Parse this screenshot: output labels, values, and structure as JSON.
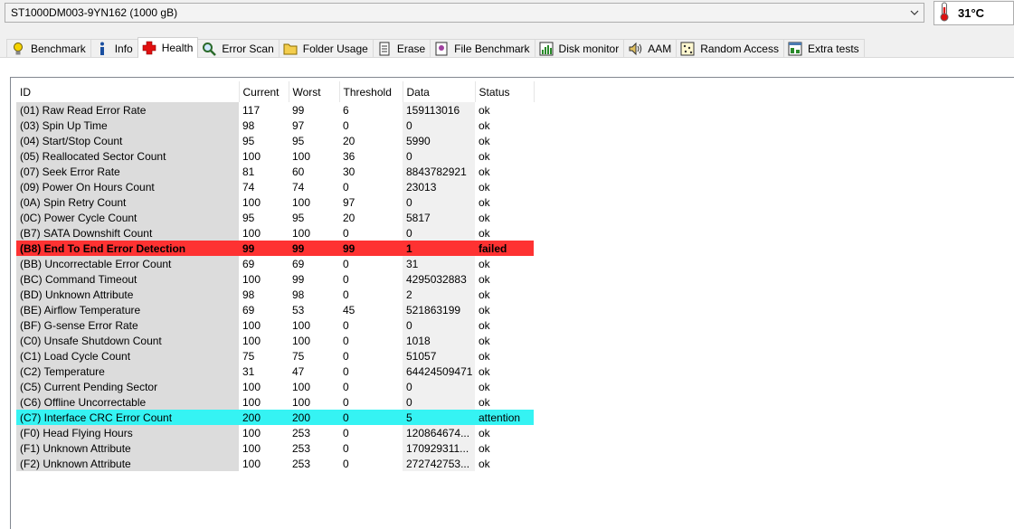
{
  "drive": {
    "name": "ST1000DM003-9YN162 (1000 gB)",
    "temperature": "31°C"
  },
  "tabs": [
    {
      "label": "Benchmark",
      "icon": "lightbulb-icon",
      "active": false
    },
    {
      "label": "Info",
      "icon": "info-icon",
      "active": false
    },
    {
      "label": "Health",
      "icon": "health-cross-icon",
      "active": true
    },
    {
      "label": "Error Scan",
      "icon": "magnifier-icon",
      "active": false
    },
    {
      "label": "Folder Usage",
      "icon": "folder-icon",
      "active": false
    },
    {
      "label": "Erase",
      "icon": "erase-icon",
      "active": false
    },
    {
      "label": "File Benchmark",
      "icon": "file-benchmark-icon",
      "active": false
    },
    {
      "label": "Disk monitor",
      "icon": "disk-monitor-icon",
      "active": false
    },
    {
      "label": "AAM",
      "icon": "speaker-icon",
      "active": false
    },
    {
      "label": "Random Access",
      "icon": "random-access-icon",
      "active": false
    },
    {
      "label": "Extra tests",
      "icon": "extra-tests-icon",
      "active": false
    }
  ],
  "columns": [
    "ID",
    "Current",
    "Worst",
    "Threshold",
    "Data",
    "Status"
  ],
  "rows": [
    {
      "id": "(01) Raw Read Error Rate",
      "current": "117",
      "worst": "99",
      "threshold": "6",
      "data": "159113016",
      "status": "ok",
      "state": "ok"
    },
    {
      "id": "(03) Spin Up Time",
      "current": "98",
      "worst": "97",
      "threshold": "0",
      "data": "0",
      "status": "ok",
      "state": "ok"
    },
    {
      "id": "(04) Start/Stop Count",
      "current": "95",
      "worst": "95",
      "threshold": "20",
      "data": "5990",
      "status": "ok",
      "state": "ok"
    },
    {
      "id": "(05) Reallocated Sector Count",
      "current": "100",
      "worst": "100",
      "threshold": "36",
      "data": "0",
      "status": "ok",
      "state": "ok"
    },
    {
      "id": "(07) Seek Error Rate",
      "current": "81",
      "worst": "60",
      "threshold": "30",
      "data": "8843782921",
      "status": "ok",
      "state": "ok"
    },
    {
      "id": "(09) Power On Hours Count",
      "current": "74",
      "worst": "74",
      "threshold": "0",
      "data": "23013",
      "status": "ok",
      "state": "ok"
    },
    {
      "id": "(0A) Spin Retry Count",
      "current": "100",
      "worst": "100",
      "threshold": "97",
      "data": "0",
      "status": "ok",
      "state": "ok"
    },
    {
      "id": "(0C) Power Cycle Count",
      "current": "95",
      "worst": "95",
      "threshold": "20",
      "data": "5817",
      "status": "ok",
      "state": "ok"
    },
    {
      "id": "(B7) SATA Downshift Count",
      "current": "100",
      "worst": "100",
      "threshold": "0",
      "data": "0",
      "status": "ok",
      "state": "ok"
    },
    {
      "id": "(B8) End To End Error Detection",
      "current": "99",
      "worst": "99",
      "threshold": "99",
      "data": "1",
      "status": "failed",
      "state": "failed"
    },
    {
      "id": "(BB) Uncorrectable Error Count",
      "current": "69",
      "worst": "69",
      "threshold": "0",
      "data": "31",
      "status": "ok",
      "state": "ok"
    },
    {
      "id": "(BC) Command Timeout",
      "current": "100",
      "worst": "99",
      "threshold": "0",
      "data": "4295032883",
      "status": "ok",
      "state": "ok"
    },
    {
      "id": "(BD) Unknown Attribute",
      "current": "98",
      "worst": "98",
      "threshold": "0",
      "data": "2",
      "status": "ok",
      "state": "ok"
    },
    {
      "id": "(BE) Airflow Temperature",
      "current": "69",
      "worst": "53",
      "threshold": "45",
      "data": "521863199",
      "status": "ok",
      "state": "ok"
    },
    {
      "id": "(BF) G-sense Error Rate",
      "current": "100",
      "worst": "100",
      "threshold": "0",
      "data": "0",
      "status": "ok",
      "state": "ok"
    },
    {
      "id": "(C0) Unsafe Shutdown Count",
      "current": "100",
      "worst": "100",
      "threshold": "0",
      "data": "1018",
      "status": "ok",
      "state": "ok"
    },
    {
      "id": "(C1) Load Cycle Count",
      "current": "75",
      "worst": "75",
      "threshold": "0",
      "data": "51057",
      "status": "ok",
      "state": "ok"
    },
    {
      "id": "(C2) Temperature",
      "current": "31",
      "worst": "47",
      "threshold": "0",
      "data": "64424509471",
      "status": "ok",
      "state": "ok"
    },
    {
      "id": "(C5) Current Pending Sector",
      "current": "100",
      "worst": "100",
      "threshold": "0",
      "data": "0",
      "status": "ok",
      "state": "ok"
    },
    {
      "id": "(C6) Offline Uncorrectable",
      "current": "100",
      "worst": "100",
      "threshold": "0",
      "data": "0",
      "status": "ok",
      "state": "ok"
    },
    {
      "id": "(C7) Interface CRC Error Count",
      "current": "200",
      "worst": "200",
      "threshold": "0",
      "data": "5",
      "status": "attention",
      "state": "attention"
    },
    {
      "id": "(F0) Head Flying Hours",
      "current": "100",
      "worst": "253",
      "threshold": "0",
      "data": "120864674...",
      "status": "ok",
      "state": "ok"
    },
    {
      "id": "(F1) Unknown Attribute",
      "current": "100",
      "worst": "253",
      "threshold": "0",
      "data": "170929311...",
      "status": "ok",
      "state": "ok"
    },
    {
      "id": "(F2) Unknown Attribute",
      "current": "100",
      "worst": "253",
      "threshold": "0",
      "data": "272742753...",
      "status": "ok",
      "state": "ok"
    }
  ],
  "colors": {
    "failed": "#fe3232",
    "attention": "#35f3f3"
  }
}
